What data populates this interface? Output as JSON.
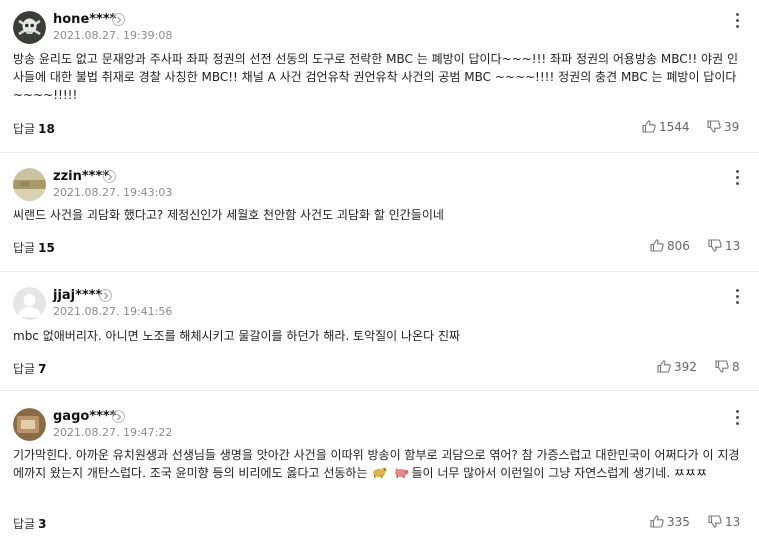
{
  "comments": [
    {
      "username": "hone****",
      "timestamp": "2021.08.27. 19:39:08",
      "text": "방송 윤리도 없고 문재앙과 주사파 좌파 정권의 선전 선동의 도구로 전락한 MBC 는 폐방이 답이다~~~!!! 좌파 정권의 어용방송 MBC!! 야권 인사들에 대한 불법 취재로 경찰 사칭한 MBC!! 채널 A 사건 검언유착 권언유착 사건의 공범 MBC ~~~~!!!! 정권의 충견 MBC 는 폐방이 답이다~~~~!!!!!",
      "reply_label": "답글",
      "reply_count": "18",
      "likes": "1544",
      "dislikes": "39",
      "avatar_icon": "pirate-skull-avatar"
    },
    {
      "username": "zzin****",
      "timestamp": "2021.08.27. 19:43:03",
      "text": "씨랜드 사건을 괴담화 했다고? 제정신인가 세월호 천안함 사건도 괴담화 할 인간들이네",
      "reply_label": "답글",
      "reply_count": "15",
      "likes": "806",
      "dislikes": "13",
      "avatar_icon": "photo-avatar"
    },
    {
      "username": "jjaj****",
      "timestamp": "2021.08.27. 19:41:56",
      "text": "mbc 없애버리자. 아니면 노조를 해체시키고 물갈이를 하던가 해라. 토악질이 나온다 진짜",
      "reply_label": "답글",
      "reply_count": "7",
      "likes": "392",
      "dislikes": "8",
      "avatar_icon": "default-person-avatar"
    },
    {
      "username": "gago****",
      "timestamp": "2021.08.27. 19:47:22",
      "text_before": "기가막힌다. 아까운 유치원생과 선생님들 생명을 앗아간 사건을 이따위 방송이 함부로 괴담으로 엮어? 참 가증스럽고 대한민국이 어쩌다가 이 지경에까지 왔는지 개탄스럽다. 조국 윤미향 등의 비리에도 옳다고 선동하는",
      "text_after": "들이 너무 많아서 이런일이 그냥 자연스럽게 생기네. ㅉㅉㅉ",
      "reply_label": "답글",
      "reply_count": "3",
      "likes": "335",
      "dislikes": "13",
      "avatar_icon": "photo-avatar",
      "inline_icons": [
        "dog-emoji",
        "pig-emoji"
      ]
    }
  ],
  "colors": {
    "username": "#111111",
    "timestamp": "#8c8c8c",
    "divider": "#ebebeb",
    "vote_text": "#666666"
  }
}
